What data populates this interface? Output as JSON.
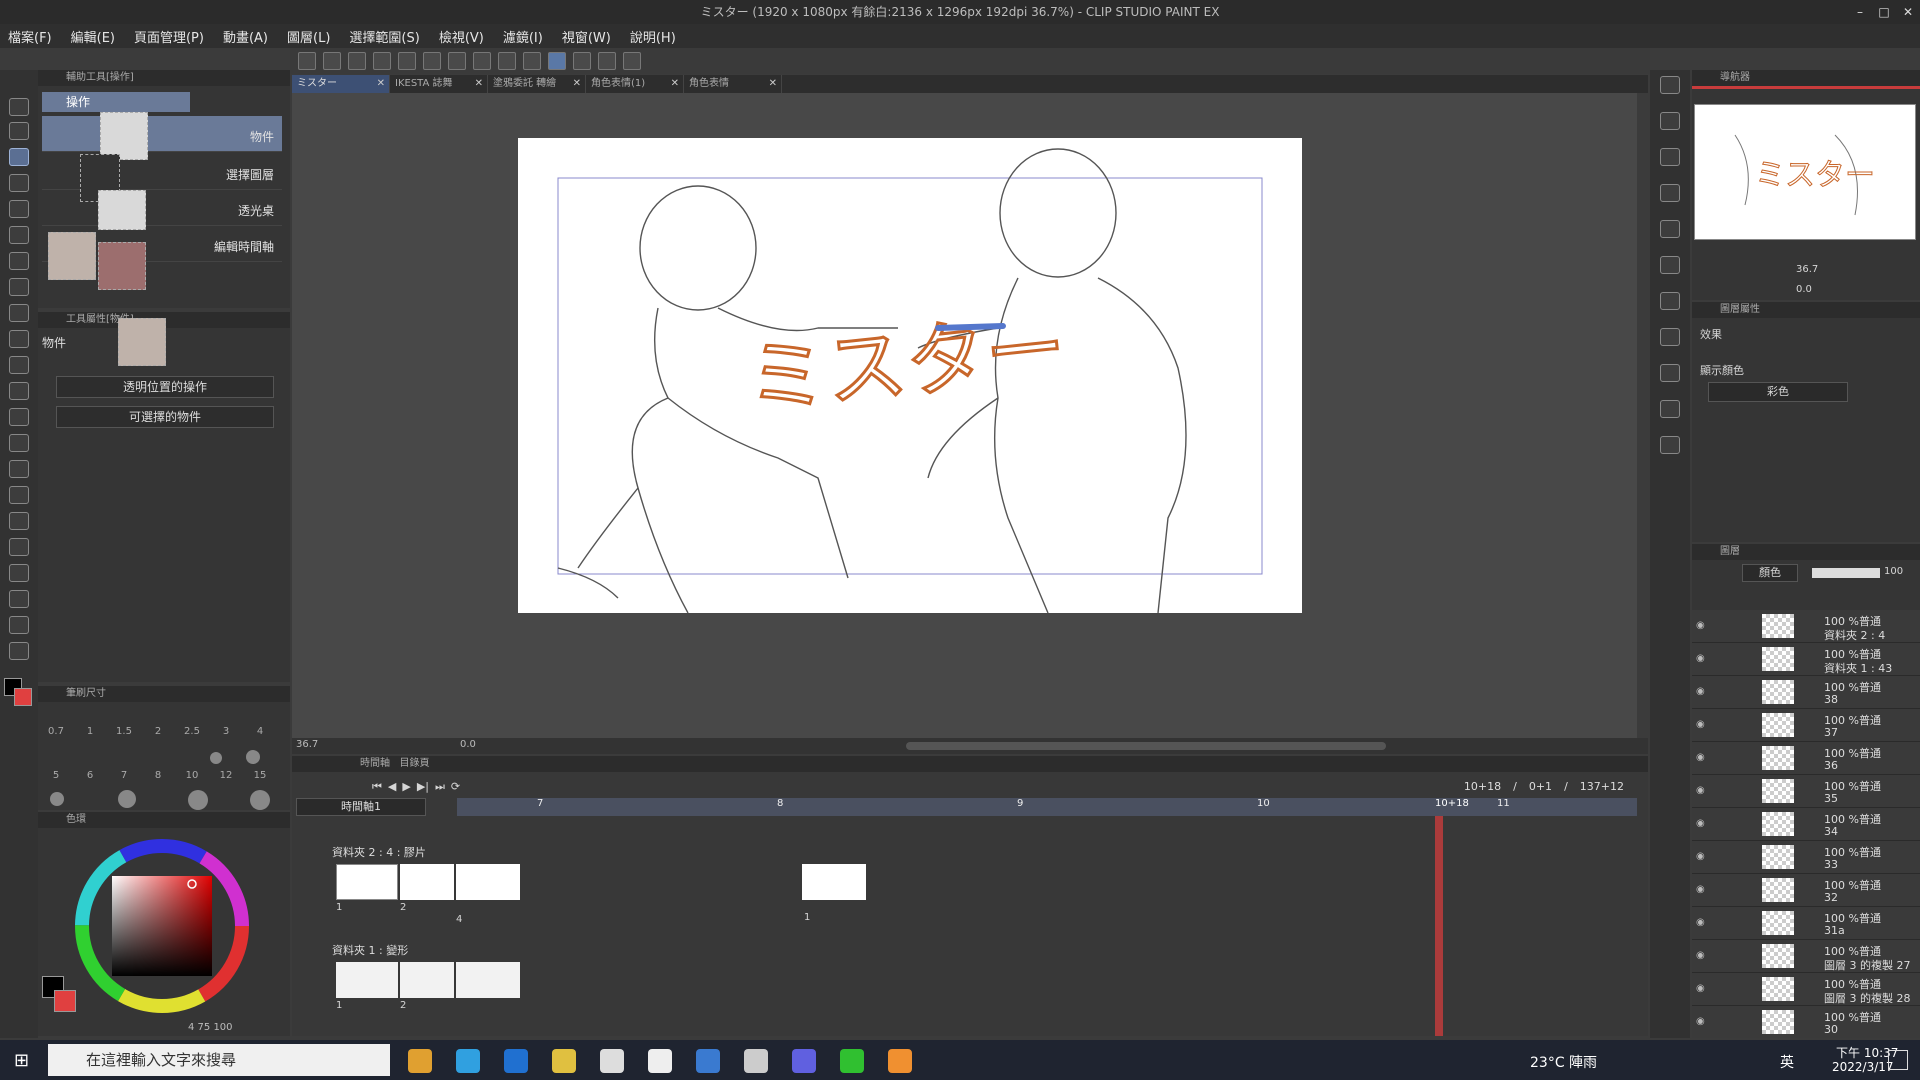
{
  "window": {
    "title": "ミスター (1920 x 1080px 有餘白:2136 x 1296px 192dpi 36.7%) - CLIP STUDIO PAINT EX",
    "controls": [
      "–",
      "□",
      "✕"
    ]
  },
  "menu": {
    "items": [
      "檔案(F)",
      "編輯(E)",
      "頁面管理(P)",
      "動畫(A)",
      "圖層(L)",
      "選擇範圍(S)",
      "檢視(V)",
      "濾鏡(I)",
      "視窗(W)",
      "說明(H)"
    ]
  },
  "subtool": {
    "header": "輔助工具[操作]",
    "group": "操作",
    "items": [
      "物件",
      "選擇圖層",
      "透光桌",
      "編輯時間軸"
    ]
  },
  "toolprop": {
    "header": "工具屬性[物件]",
    "name": "物件",
    "dropdown1": "透明位置的操作",
    "dropdown2": "可選擇的物件"
  },
  "brushsize": {
    "header": "筆刷尺寸",
    "row1": [
      "0.7",
      "1",
      "1.5",
      "2",
      "2.5",
      "3",
      "4"
    ],
    "row2": [
      "5",
      "6",
      "7",
      "8",
      "10",
      "12",
      "15"
    ]
  },
  "colorpanel": {
    "header": "色環",
    "readout": "4  75  100"
  },
  "doctabs": [
    "ミスター",
    "IKESTA 誌舞",
    "塗鴉委託 轉繪",
    "角色表情(1)",
    "角色表情"
  ],
  "canvas": {
    "logo_text": "ミスター"
  },
  "status": {
    "zoom": "36.7",
    "angle": "0.0"
  },
  "timeline": {
    "header": "時間軸",
    "tab2": "目錄頁",
    "name": "時間軸1",
    "frame_current": "10+18",
    "frame_sep1": "/",
    "frame_total": "0+1",
    "frame_sep2": "/",
    "frame_end": "137+12",
    "seconds": [
      "7",
      "8",
      "9",
      "10",
      "10+18",
      "11"
    ],
    "tracks": [
      {
        "name": "資料夾 2 : 4 : 膠片",
        "cels": [
          "1",
          "2",
          "4"
        ],
        "cel2_label": "1"
      },
      {
        "name": "資料夾 1 : 變形",
        "cels": [
          "1",
          "2"
        ]
      }
    ]
  },
  "navigator": {
    "header": "導航器",
    "zoom": "36.7",
    "angle": "0.0"
  },
  "layerprop": {
    "header": "圖層屬性",
    "effect_label": "效果",
    "display_color_label": "顯示顏色",
    "display_color_value": "彩色"
  },
  "layers": {
    "header": "圖層",
    "blend": "顏色",
    "opacity": "100",
    "rows": [
      {
        "l1": "100 %普通",
        "l2": "資料夾 2 : 4"
      },
      {
        "l1": "100 %普通",
        "l2": "資料夾 1 : 43"
      },
      {
        "l1": "100 %普通",
        "l2": "38"
      },
      {
        "l1": "100 %普通",
        "l2": "37"
      },
      {
        "l1": "100 %普通",
        "l2": "36"
      },
      {
        "l1": "100 %普通",
        "l2": "35"
      },
      {
        "l1": "100 %普通",
        "l2": "34"
      },
      {
        "l1": "100 %普通",
        "l2": "33"
      },
      {
        "l1": "100 %普通",
        "l2": "32"
      },
      {
        "l1": "100 %普通",
        "l2": "31a"
      },
      {
        "l1": "100 %普通",
        "l2": "圖層 3 的複製 27"
      },
      {
        "l1": "100 %普通",
        "l2": "圖層 3 的複製 28"
      },
      {
        "l1": "100 %普通",
        "l2": "30"
      }
    ]
  },
  "taskbar": {
    "search_placeholder": "在這裡輸入文字來搜尋",
    "weather": "23°C  陣雨",
    "ime": "英",
    "time": "下午 10:37",
    "date": "2022/3/17"
  },
  "colors": {
    "accent_blue": "#5b6f93",
    "logo_orange": "#c8662a",
    "playhead_red": "#c83c3c",
    "canvas_bg": "#484848"
  }
}
